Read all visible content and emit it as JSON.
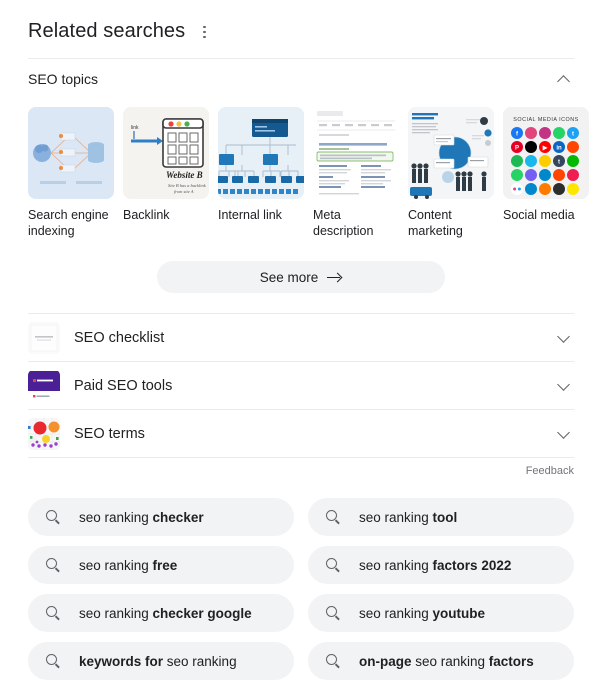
{
  "header": {
    "title": "Related searches",
    "menu_icon": "kebab-menu-icon"
  },
  "topics_section": {
    "label": "SEO topics",
    "expanded": true,
    "chevron_icon": "chevron-up-icon",
    "cards": [
      {
        "label": "Search engine indexing",
        "thumb": "search-engine-indexing-diagram"
      },
      {
        "label": "Backlink",
        "thumb": "backlink-website-b-diagram"
      },
      {
        "label": "Internal link",
        "thumb": "internal-link-tree-diagram"
      },
      {
        "label": "Meta description",
        "thumb": "meta-description-serp-screenshot"
      },
      {
        "label": "Content marketing",
        "thumb": "content-marketing-infographic"
      },
      {
        "label": "Social media",
        "thumb": "social-media-icons-grid"
      }
    ],
    "see_more": {
      "label": "See more",
      "icon": "arrow-right-icon"
    }
  },
  "accordion_rows": [
    {
      "label": "SEO checklist",
      "chevron_icon": "chevron-down-icon",
      "thumb": "seo-checklist-document"
    },
    {
      "label": "Paid SEO tools",
      "chevron_icon": "chevron-down-icon",
      "thumb": "paid-seo-tools-purple-card"
    },
    {
      "label": "SEO terms",
      "chevron_icon": "chevron-down-icon",
      "thumb": "seo-terms-bubble-chart"
    }
  ],
  "feedback": {
    "label": "Feedback"
  },
  "search_chips": [
    {
      "icon": "search-icon",
      "parts": [
        {
          "t": "seo ranking ",
          "b": false
        },
        {
          "t": "checker",
          "b": true
        }
      ]
    },
    {
      "icon": "search-icon",
      "parts": [
        {
          "t": "seo ranking ",
          "b": false
        },
        {
          "t": "tool",
          "b": true
        }
      ]
    },
    {
      "icon": "search-icon",
      "parts": [
        {
          "t": "seo ranking ",
          "b": false
        },
        {
          "t": "free",
          "b": true
        }
      ]
    },
    {
      "icon": "search-icon",
      "parts": [
        {
          "t": "seo ranking ",
          "b": false
        },
        {
          "t": "factors 2022",
          "b": true
        }
      ]
    },
    {
      "icon": "search-icon",
      "parts": [
        {
          "t": "seo ranking ",
          "b": false
        },
        {
          "t": "checker google",
          "b": true
        }
      ]
    },
    {
      "icon": "search-icon",
      "parts": [
        {
          "t": "seo ranking ",
          "b": false
        },
        {
          "t": "youtube",
          "b": true
        }
      ]
    },
    {
      "icon": "search-icon",
      "parts": [
        {
          "t": "keywords for",
          "b": true
        },
        {
          "t": " seo ranking",
          "b": false
        }
      ]
    },
    {
      "icon": "search-icon",
      "parts": [
        {
          "t": "on-page",
          "b": true
        },
        {
          "t": " seo ranking ",
          "b": false
        },
        {
          "t": "factors",
          "b": true
        }
      ]
    }
  ],
  "colors": {
    "chip_bg": "#f1f3f4",
    "text": "#202124",
    "muted": "#70757a",
    "divider": "#ebebeb"
  }
}
